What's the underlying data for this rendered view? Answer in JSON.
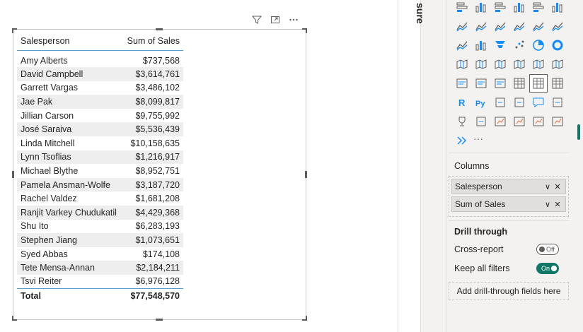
{
  "table": {
    "columns": [
      "Salesperson",
      "Sum of Sales"
    ],
    "rows": [
      [
        "Amy Alberts",
        "$737,568"
      ],
      [
        "David Campbell",
        "$3,614,761"
      ],
      [
        "Garrett Vargas",
        "$3,486,102"
      ],
      [
        "Jae Pak",
        "$8,099,817"
      ],
      [
        "Jillian Carson",
        "$9,755,992"
      ],
      [
        "José Saraiva",
        "$5,536,439"
      ],
      [
        "Linda Mitchell",
        "$10,158,635"
      ],
      [
        "Lynn Tsoflias",
        "$1,216,917"
      ],
      [
        "Michael Blythe",
        "$8,952,751"
      ],
      [
        "Pamela Ansman-Wolfe",
        "$3,187,720"
      ],
      [
        "Rachel Valdez",
        "$1,681,208"
      ],
      [
        "Ranjit Varkey Chudukatil",
        "$4,429,368"
      ],
      [
        "Shu Ito",
        "$6,283,193"
      ],
      [
        "Stephen Jiang",
        "$1,073,651"
      ],
      [
        "Syed Abbas",
        "$174,108"
      ],
      [
        "Tete Mensa-Annan",
        "$2,184,211"
      ],
      [
        "Tsvi Reiter",
        "$6,976,128"
      ]
    ],
    "total_label": "Total",
    "total_value": "$77,548,570"
  },
  "panes": {
    "collapsed_label": "sure",
    "more_visuals": "···"
  },
  "build": {
    "columns_label": "Columns",
    "columns": [
      {
        "label": "Salesperson",
        "chevron": "∨",
        "remove": "✕"
      },
      {
        "label": "Sum of Sales",
        "chevron": "∨",
        "remove": "✕"
      }
    ]
  },
  "drill_through": {
    "heading": "Drill through",
    "cross_report_label": "Cross-report",
    "cross_report_state": "Off",
    "keep_filters_label": "Keep all filters",
    "keep_filters_state": "On",
    "add_fields": "Add drill-through fields here"
  },
  "colors": {
    "accent": "#117865",
    "header_rule": "#5b9bd5",
    "band": "#eeeeee",
    "pane_bg": "#f3f2f1"
  },
  "viz_icons": [
    "stacked-bar-icon",
    "stacked-column-icon",
    "clustered-bar-icon",
    "clustered-column-icon",
    "100-bar-icon",
    "100-column-icon",
    "line-chart-icon",
    "area-chart-icon",
    "stacked-area-icon",
    "ribbon-icon",
    "line-clustered-icon",
    "line-stacked-icon",
    "ribbon-chart-icon",
    "waterfall-icon",
    "funnel-icon",
    "scatter-icon",
    "pie-icon",
    "donut-icon",
    "treemap-icon",
    "map-icon",
    "filled-map-icon",
    "shape-map-icon",
    "azure-map-icon",
    "gauge-icon",
    "card-icon",
    "multi-row-card-icon",
    "kpi-icon",
    "slicer-icon",
    "table-icon",
    "matrix-icon",
    "r-visual-icon",
    "python-visual-icon",
    "key-influencers-icon",
    "decomposition-tree-icon",
    "qa-icon",
    "paginated-icon",
    "trophy-icon",
    "report-icon",
    "power-apps-icon",
    "power-automate-icon",
    "metrics-icon",
    "custom-visual-icon",
    "narrative-icon"
  ]
}
